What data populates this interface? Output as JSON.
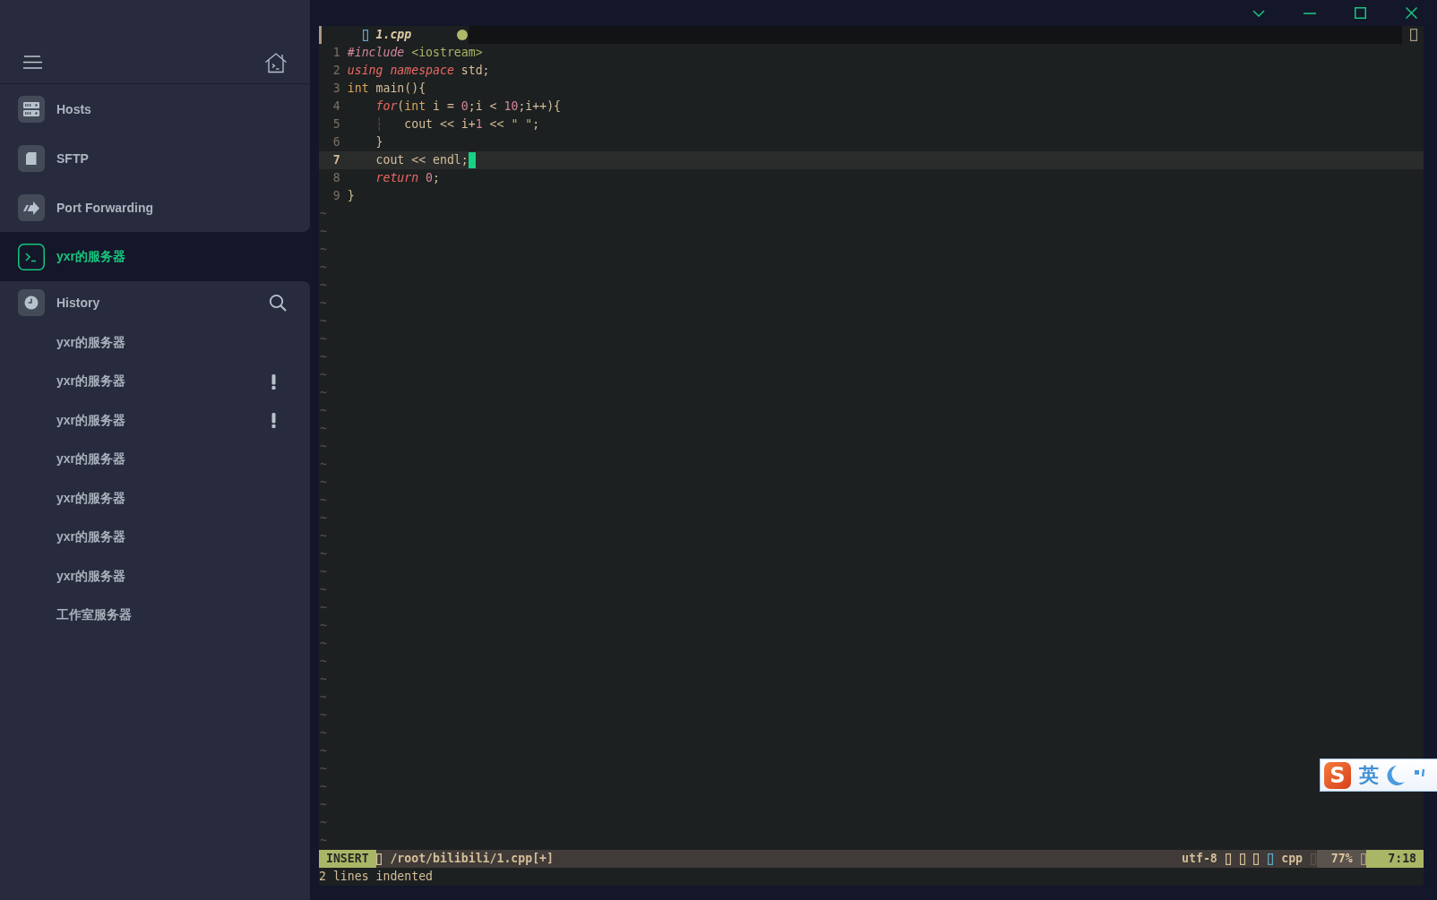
{
  "sidebar": {
    "items": [
      {
        "label": "Hosts",
        "kind": "hosts",
        "selected": false
      },
      {
        "label": "SFTP",
        "kind": "sftp",
        "selected": false
      },
      {
        "label": "Port Forwarding",
        "kind": "forwarding",
        "selected": false
      },
      {
        "label": "yxr的服务器",
        "kind": "terminal",
        "selected": true
      }
    ],
    "history": {
      "title": "History",
      "items": [
        {
          "label": "yxr的服务器",
          "warning": false
        },
        {
          "label": "yxr的服务器",
          "warning": true
        },
        {
          "label": "yxr的服务器",
          "warning": true
        },
        {
          "label": "yxr的服务器",
          "warning": false
        },
        {
          "label": "yxr的服务器",
          "warning": false
        },
        {
          "label": "yxr的服务器",
          "warning": false
        },
        {
          "label": "yxr的服务器",
          "warning": false
        },
        {
          "label": "工作室服务器",
          "warning": false
        }
      ]
    }
  },
  "editor": {
    "tabs": [
      {
        "label": "1.cpp",
        "modified": true,
        "selected": true
      }
    ],
    "lines": [
      {
        "number": "1",
        "current": false,
        "cursor": false,
        "tokens": [
          {
            "kind": "preproc",
            "text": "#include "
          },
          {
            "kind": "string",
            "text": "<iostream>"
          }
        ]
      },
      {
        "number": "2",
        "current": false,
        "cursor": false,
        "tokens": [
          {
            "kind": "keyword",
            "text": "using "
          },
          {
            "kind": "keyword",
            "text": "namespace"
          },
          {
            "kind": "plain",
            "text": " std;"
          }
        ]
      },
      {
        "number": "3",
        "current": false,
        "cursor": false,
        "tokens": [
          {
            "kind": "type",
            "text": "int"
          },
          {
            "kind": "plain",
            "text": " main(){"
          }
        ]
      },
      {
        "number": "4",
        "current": false,
        "cursor": false,
        "tokens": [
          {
            "kind": "keyword",
            "text": "    for"
          },
          {
            "kind": "plain",
            "text": "("
          },
          {
            "kind": "type",
            "text": "int"
          },
          {
            "kind": "plain",
            "text": " i = "
          },
          {
            "kind": "number",
            "text": "0"
          },
          {
            "kind": "plain",
            "text": ";i < "
          },
          {
            "kind": "number",
            "text": "10"
          },
          {
            "kind": "plain",
            "text": ";i++){"
          }
        ]
      },
      {
        "number": "5",
        "current": false,
        "cursor": false,
        "tokens": [
          {
            "kind": "guide",
            "text": "    ┆"
          },
          {
            "kind": "plain",
            "text": "   cout << i+"
          },
          {
            "kind": "number",
            "text": "1"
          },
          {
            "kind": "plain",
            "text": " << "
          },
          {
            "kind": "string",
            "text": "\" \""
          },
          {
            "kind": "plain",
            "text": ";"
          }
        ]
      },
      {
        "number": "6",
        "current": false,
        "cursor": false,
        "tokens": [
          {
            "kind": "plain",
            "text": "    }"
          }
        ]
      },
      {
        "number": "7",
        "current": true,
        "cursor": true,
        "tokens": [
          {
            "kind": "plain",
            "text": "    cout << endl;"
          }
        ]
      },
      {
        "number": "8",
        "current": false,
        "cursor": false,
        "tokens": [
          {
            "kind": "keyword",
            "text": "    return "
          },
          {
            "kind": "number",
            "text": "0"
          },
          {
            "kind": "plain",
            "text": ";"
          }
        ]
      },
      {
        "number": "9",
        "current": false,
        "cursor": false,
        "tokens": [
          {
            "kind": "plain",
            "text": "}"
          }
        ]
      }
    ],
    "filler": [
      "~",
      "~",
      "~",
      "~",
      "~",
      "~",
      "~",
      "~",
      "~",
      "~",
      "~",
      "~",
      "~",
      "~",
      "~",
      "~",
      "~",
      "~",
      "~",
      "~",
      "~",
      "~",
      "~",
      "~",
      "~",
      "~",
      "~",
      "~",
      "~",
      "~",
      "~",
      "~",
      "~",
      "~",
      "~",
      "~"
    ],
    "status_bar": {
      "mode": "INSERT",
      "path": "/root/bilibili/1.cpp[+]",
      "encoding": "utf-8",
      "filetype": "cpp",
      "percent": "77%",
      "position": "7:18"
    },
    "message": "2 lines indented"
  },
  "ime_toolbar": {
    "logo": "S",
    "mode": "英"
  }
}
